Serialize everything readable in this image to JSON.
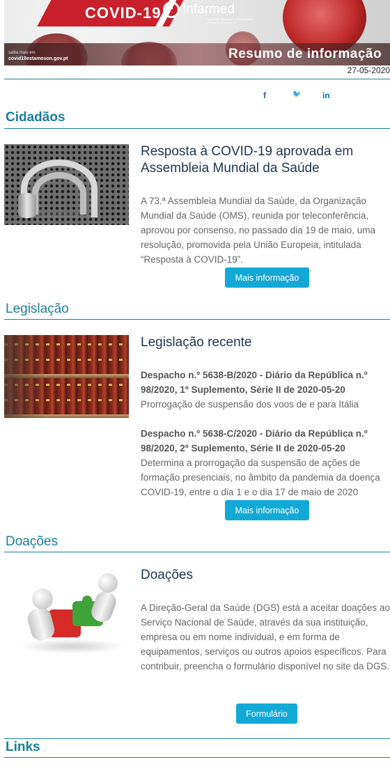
{
  "header": {
    "banner_title": "COVID-19",
    "logo_name": "Infarmed",
    "logo_subtitle": "Autoridade Nacional do Medicamento e Produtos de Saúde I.P.",
    "site_prefix": "saiba mais em",
    "site_url": "covid19estamoson.gov.pt",
    "banner_subtitle": "Resumo de informação",
    "date": "27-05-2020"
  },
  "social": {
    "facebook": "f",
    "twitter": "🐦",
    "linkedin": "in"
  },
  "sections": {
    "cidadaos": {
      "title": "Cidadãos",
      "article_title": "Resposta à COVID-19 aprovada em Assembleia Mundial da Saúde",
      "body": "A 73.ª Assembleia Mundial da Saúde, da Organização Mundial da Saúde (OMS), reunida por teleconferência, aprovou por consenso, no passado dia 19 de maio, uma resolução, promovida pela União Europeia, intitulada “Resposta à COVID-19”.",
      "button": "Mais informação"
    },
    "legislacao": {
      "title": "Legislação",
      "article_title": "Legislação recente",
      "items": [
        {
          "heading": "Despacho n.º 5638-B/2020 - Diário da República n.º 98/2020, 1º Suplemento, Série II de 2020-05-20",
          "text": "Prorrogação de suspensão dos voos de e para Itália"
        },
        {
          "heading": "Despacho n.º 5638-C/2020 - Diário da República n.º 98/2020, 2º Suplemento, Série II de 2020-05-20",
          "text": "Determina a prorrogação da suspensão de ações de formação presenciais, no âmbito da pandemia da doença COVID-19, entre o dia 1 e o dia 17 de maio de 2020"
        }
      ],
      "button": "Mais informação"
    },
    "doacoes": {
      "title": "Doações",
      "article_title": "Doações",
      "body": "A Direção-Geral da Saúde (DGS) está a aceitar doações ao Serviço Nacional de Saúde, através da sua instituição, empresa ou em nome individual, e em forma de equipamentos, serviços ou outros apoios específicos. Para contribuir, preencha o formulário disponível no site da DGS.",
      "button": "Formulário"
    },
    "links": {
      "title": "Links"
    }
  },
  "colors": {
    "accent": "#1a7f9a",
    "button": "#13a9d6",
    "title": "#1e3550",
    "banner_red": "#c9202c"
  }
}
